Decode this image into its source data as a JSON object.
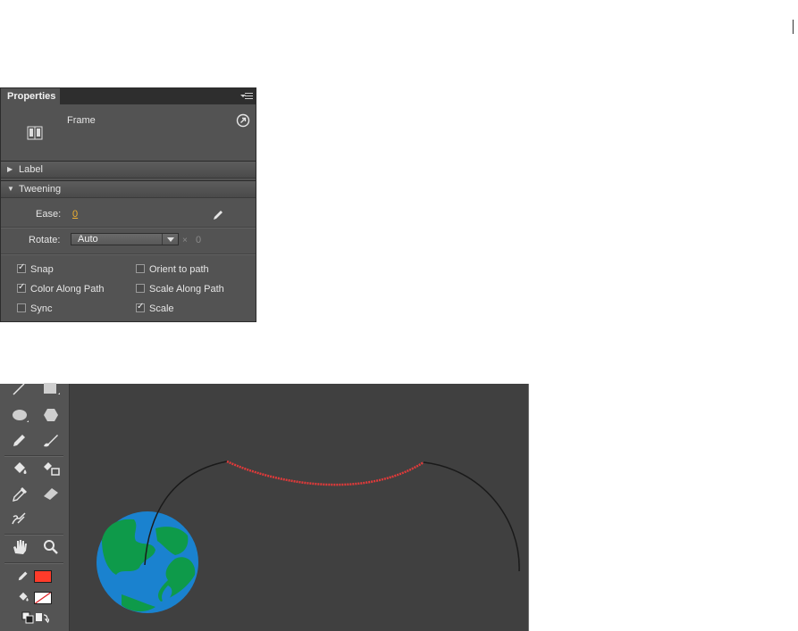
{
  "properties_panel": {
    "tab_label": "Properties",
    "frame_label": "Frame",
    "sections": {
      "label": "Label",
      "tweening": "Tweening"
    },
    "ease": {
      "label": "Ease:",
      "value": "0"
    },
    "rotate": {
      "label": "Rotate:",
      "value": "Auto",
      "times_symbol": "×",
      "count": "0"
    },
    "options": [
      {
        "label": "Snap",
        "checked": true
      },
      {
        "label": "Orient to path",
        "checked": false
      },
      {
        "label": "Color Along Path",
        "checked": true
      },
      {
        "label": "Scale Along Path",
        "checked": false
      },
      {
        "label": "Sync",
        "checked": false
      },
      {
        "label": "Scale",
        "checked": true
      }
    ],
    "accent_color": "#f0b030"
  },
  "toolbar": {
    "tools": [
      "line-icon",
      "rectangle-icon",
      "oval-icon",
      "polystar-icon",
      "pencil-icon",
      "brush-icon",
      "paint-bucket-icon",
      "ink-bottle-icon",
      "eyedropper-icon",
      "eraser-icon",
      "bone-icon",
      "hand-icon",
      "zoom-icon"
    ],
    "stroke_color": "#ff3b2a",
    "fill_color": "none"
  },
  "stage": {
    "background": "#404040",
    "path_color": "#1a1a1a",
    "selected_segment_color": "#e03a3a",
    "globe_colors": {
      "ocean": "#1a82cf",
      "land": "#0e9a4a"
    }
  }
}
